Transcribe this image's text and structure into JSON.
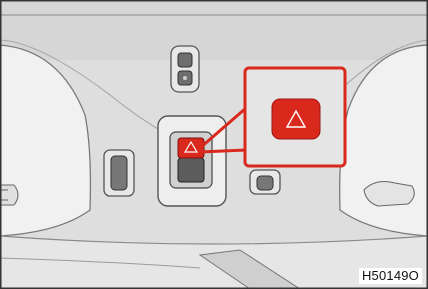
{
  "figure": {
    "code": "H50149O",
    "callout_icon": "hazard-triangle-icon",
    "accent_color": "#d9281c"
  }
}
